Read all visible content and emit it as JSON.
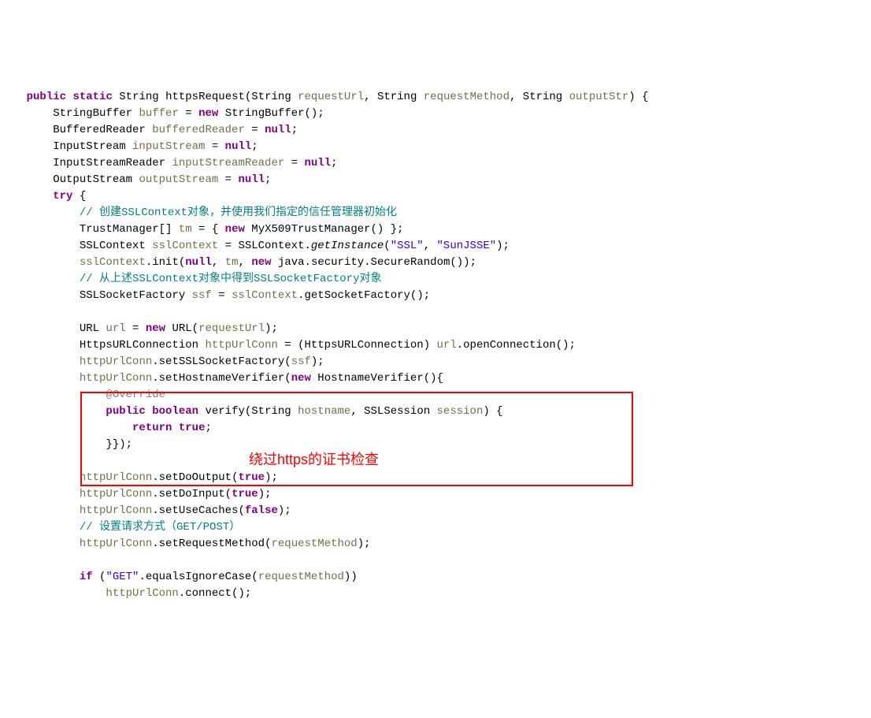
{
  "t": {
    "kw_public": "public",
    "kw_static": "static",
    "kw_new": "new",
    "kw_try": "try",
    "kw_null": "null",
    "kw_true": "true",
    "kw_false": "false",
    "kw_boolean": "boolean",
    "kw_return": "return",
    "kw_if": "if",
    "type_String": "String",
    "type_StringBuffer": "StringBuffer",
    "type_BufferedReader": "BufferedReader",
    "type_InputStream": "InputStream",
    "type_InputStreamReader": "InputStreamReader",
    "type_OutputStream": "OutputStream",
    "type_TrustManager": "TrustManager[]",
    "type_MyX509TM": "MyX509TrustManager",
    "type_SSLContext": "SSLContext",
    "type_SSLSocketFactory": "SSLSocketFactory",
    "type_URL": "URL",
    "type_HttpsURLConnection": "HttpsURLConnection",
    "type_HostnameVerifier": "HostnameVerifier",
    "type_SSLSession": "SSLSession",
    "method_httpsRequest": "httpsRequest",
    "method_getInstance": "getInstance",
    "method_init": "init",
    "method_SecureRandom": "java.security.SecureRandom",
    "method_getSocketFactory": "getSocketFactory",
    "method_openConnection": "openConnection",
    "method_setSSLSocketFactory": "setSSLSocketFactory",
    "method_setHostnameVerifier": "setHostnameVerifier",
    "method_verify": "verify",
    "method_setDoOutput": "setDoOutput",
    "method_setDoInput": "setDoInput",
    "method_setUseCaches": "setUseCaches",
    "method_setRequestMethod": "setRequestMethod",
    "method_equalsIgnoreCase": "equalsIgnoreCase",
    "method_connect": "connect",
    "var_requestUrl": "requestUrl",
    "var_requestMethod": "requestMethod",
    "var_outputStr": "outputStr",
    "var_buffer": "buffer",
    "var_bufferedReader": "bufferedReader",
    "var_inputStream": "inputStream",
    "var_inputStreamReader": "inputStreamReader",
    "var_outputStream": "outputStream",
    "var_tm": "tm",
    "var_sslContext": "sslContext",
    "var_ssf": "ssf",
    "var_url": "url",
    "var_httpUrlConn": "httpUrlConn",
    "var_hostname": "hostname",
    "var_session": "session",
    "comment1": "// 创建SSLContext对象，并使用我们指定的信任管理器初始化",
    "comment2": "// 从上述SSLContext对象中得到SSLSocketFactory对象",
    "comment3": "// 设置请求方式（GET/POST）",
    "str_ssl": "\"SSL\"",
    "str_sunjsse": "\"SunJSSE\"",
    "str_get": "\"GET\"",
    "annot_Override": "@Override",
    "red_annotation": "绕过https的证书检查"
  }
}
